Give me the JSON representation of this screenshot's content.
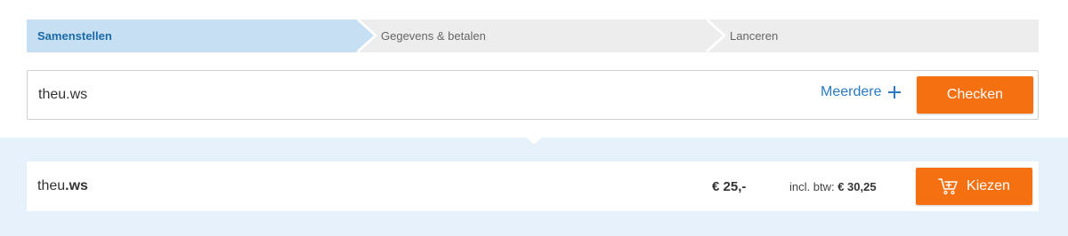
{
  "steps": [
    {
      "label": "Samenstellen",
      "active": true
    },
    {
      "label": "Gegevens & betalen",
      "active": false
    },
    {
      "label": "Lanceren",
      "active": false
    }
  ],
  "search": {
    "value": "theu.ws",
    "more_label": "Meerdere",
    "check_label": "Checken"
  },
  "result": {
    "domain_base": "theu",
    "domain_tld": ".ws",
    "price": "€ 25,-",
    "incl_label": "incl. btw:",
    "incl_value": "€ 30,25",
    "choose_label": "Kiezen"
  },
  "colors": {
    "accent_orange": "#f57011",
    "link_blue": "#2a79c0",
    "active_step_bg": "#c6dff2",
    "band_bg": "#e6f1fb"
  },
  "icons": [
    "plus-icon",
    "cart-icon"
  ]
}
